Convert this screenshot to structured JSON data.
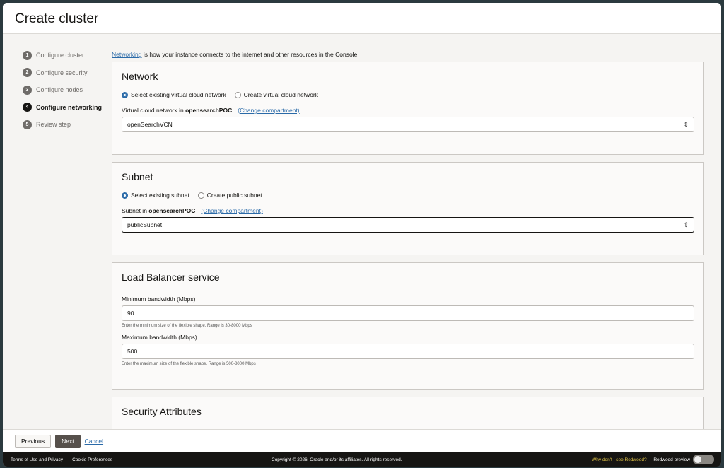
{
  "title": "Create cluster",
  "steps": [
    {
      "n": "1",
      "label": "Configure cluster"
    },
    {
      "n": "2",
      "label": "Configure security"
    },
    {
      "n": "3",
      "label": "Configure nodes"
    },
    {
      "n": "4",
      "label": "Configure networking"
    },
    {
      "n": "5",
      "label": "Review step"
    }
  ],
  "intro": {
    "link": "Networking",
    "text": " is how your instance connects to the internet and other resources in the Console."
  },
  "network": {
    "title": "Network",
    "opt1": "Select existing virtual cloud network",
    "opt2": "Create virtual cloud network",
    "label": "Virtual cloud network in ",
    "compartment": "opensearchPOC",
    "change": "(Change compartment)",
    "value": "openSearchVCN"
  },
  "subnet": {
    "title": "Subnet",
    "opt1": "Select existing subnet",
    "opt2": "Create public subnet",
    "label": "Subnet in ",
    "compartment": "opensearchPOC",
    "change": "(Change compartment)",
    "value": "publicSubnet"
  },
  "lb": {
    "title": "Load Balancer service",
    "min_label": "Minimum bandwidth (Mbps)",
    "min_value": "90",
    "min_help": "Enter the minimum size of the flexible shape. Range is 30-8000 Mbps",
    "max_label": "Maximum bandwidth (Mbps)",
    "max_value": "500",
    "max_help": "Enter the maximum size of the flexible shape. Range is 500-8000 Mbps"
  },
  "security": {
    "title": "Security Attributes"
  },
  "buttons": {
    "previous": "Previous",
    "next": "Next",
    "cancel": "Cancel"
  },
  "footer": {
    "terms": "Terms of Use and Privacy",
    "cookies": "Cookie Preferences",
    "copyright": "Copyright © 2026, Oracle and/or its affiliates. All rights reserved.",
    "why": "Why don't I see Redwood?",
    "sep": "|",
    "preview": "Redwood preview"
  }
}
